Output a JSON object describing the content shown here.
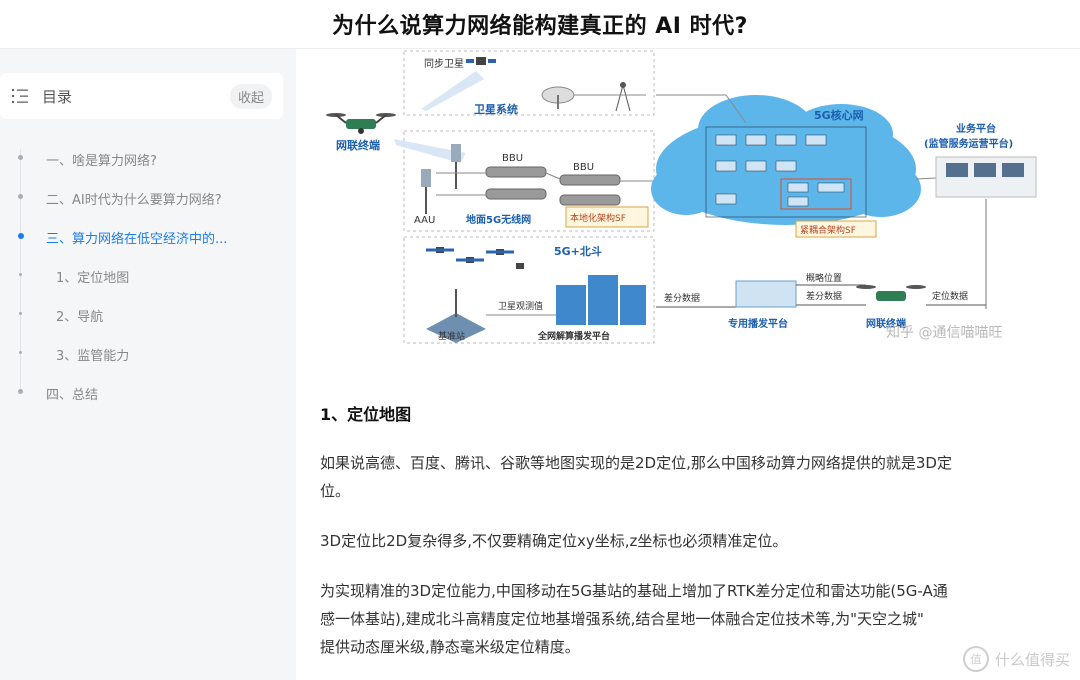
{
  "header": {
    "title": "为什么说算力网络能构建真正的 AI 时代?"
  },
  "toc": {
    "title": "目录",
    "collapse_label": "收起",
    "items": [
      {
        "label": "一、啥是算力网络?"
      },
      {
        "label": "二、AI时代为什么要算力网络?"
      },
      {
        "label": "三、算力网络在低空经济中的..."
      },
      {
        "label": "1、定位地图"
      },
      {
        "label": "2、导航"
      },
      {
        "label": "3、监管能力"
      },
      {
        "label": "四、总结"
      }
    ]
  },
  "figure": {
    "sat_label": "同步卫星",
    "sat_system": "卫星系统",
    "core_net": "5G核心网",
    "business_platform": "业务平台",
    "business_sub": "(监管服务运营平台)",
    "terminal": "网联终端",
    "bbu1": "BBU",
    "bbu2": "BBU",
    "aau": "AAU",
    "ground_5g": "地面5G无线网",
    "local_sf": "本地化架构SF",
    "tight_sf": "紧耦合架构SF",
    "beidou": "5G+北斗",
    "sat_obs": "卫星观测值",
    "base_station": "基准站",
    "full_net": "全网解算播发平台",
    "diff_data1": "差分数据",
    "diff_data2": "差分数据",
    "approx_pos": "概略位置",
    "pos_data": "定位数据",
    "dedicated": "专用播发平台",
    "terminal2": "网联终端",
    "watermark": "知乎 @通信喵喵旺"
  },
  "article": {
    "section_title": "1、定位地图",
    "para1_line1": "如果说高德、百度、腾讯、谷歌等地图实现的是2D定位,那么中国移动算力网络提供的就是3D定",
    "para1_line2": "位。",
    "para2": "3D定位比2D复杂得多,不仅要精确定位xy坐标,z坐标也必须精准定位。",
    "para3_line1": "为实现精准的3D定位能力,中国移动在5G基站的基础上增加了RTK差分定位和雷达功能(5G-A通",
    "para3_line2": "感一体基站),建成北斗高精度定位地基增强系统,结合星地一体融合定位技术等,为\"天空之城\"",
    "para3_line3": "提供动态厘米级,静态毫米级定位精度。"
  },
  "footer": {
    "badge_glyph": "值",
    "site_watermark": "什么值得买"
  }
}
